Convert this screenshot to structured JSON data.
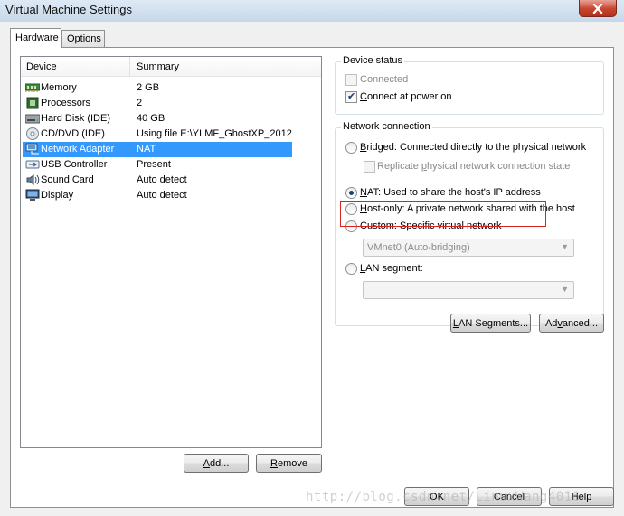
{
  "window": {
    "title": "Virtual Machine Settings",
    "close_icon": "close-icon"
  },
  "tabs": [
    {
      "label": "Hardware",
      "active": true
    },
    {
      "label": "Options",
      "active": false
    }
  ],
  "device_list": {
    "columns": [
      "Device",
      "Summary"
    ],
    "rows": [
      {
        "name": "Memory",
        "summary": "2 GB",
        "icon": "memory-icon",
        "selected": false
      },
      {
        "name": "Processors",
        "summary": "2",
        "icon": "processor-icon",
        "selected": false
      },
      {
        "name": "Hard Disk (IDE)",
        "summary": "40 GB",
        "icon": "hard-disk-icon",
        "selected": false
      },
      {
        "name": "CD/DVD (IDE)",
        "summary": "Using file E:\\YLMF_GhostXP_2012...",
        "icon": "cd-dvd-icon",
        "selected": false
      },
      {
        "name": "Network Adapter",
        "summary": "NAT",
        "icon": "network-adapter-icon",
        "selected": true
      },
      {
        "name": "USB Controller",
        "summary": "Present",
        "icon": "usb-icon",
        "selected": false
      },
      {
        "name": "Sound Card",
        "summary": "Auto detect",
        "icon": "sound-card-icon",
        "selected": false
      },
      {
        "name": "Display",
        "summary": "Auto detect",
        "icon": "display-icon",
        "selected": false
      }
    ],
    "add_label": "Add...",
    "remove_label": "Remove"
  },
  "device_status": {
    "title": "Device status",
    "connected_label": "Connected",
    "connected_checked": false,
    "connect_power_label": "Connect at power on",
    "connect_power_checked": true
  },
  "network_connection": {
    "title": "Network connection",
    "bridged_label": "Bridged: Connected directly to the physical network",
    "replicate_label": "Replicate physical network connection state",
    "nat_label": "NAT: Used to share the host's IP address",
    "host_only_label": "Host-only: A private network shared with the host",
    "custom_label": "Custom: Specific virtual network",
    "custom_value": "VMnet0 (Auto-bridging)",
    "lan_segment_label": "LAN segment:",
    "lan_segment_value": "",
    "selected": "nat"
  },
  "buttons": {
    "lan_segments": "LAN Segments...",
    "advanced": "Advanced...",
    "ok": "OK",
    "cancel": "Cancel",
    "help": "Help"
  },
  "watermark": "http://blog.csdn.net/LinuxWang4016",
  "colors": {
    "selection": "#3399ff",
    "highlight_border": "#d9231f"
  }
}
